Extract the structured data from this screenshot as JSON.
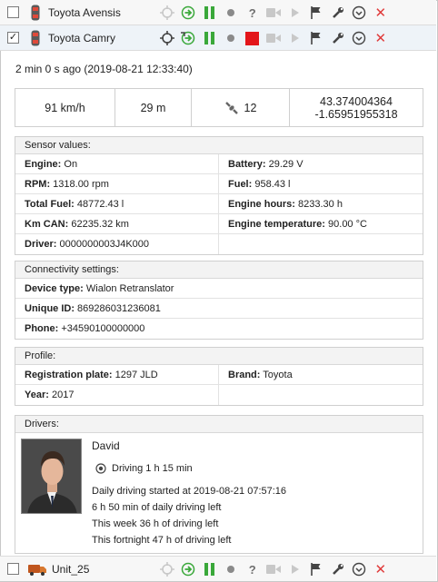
{
  "units": [
    {
      "name": "Toyota Avensis",
      "checked": false
    },
    {
      "name": "Toyota Camry",
      "checked": true
    },
    {
      "name": "Unit_25",
      "checked": false
    }
  ],
  "checkbox_mark": "✓",
  "icons": {
    "help": "?",
    "delete": "✕"
  },
  "info": {
    "time": "2 min 0 s ago (2019-08-21 12:33:40)",
    "speed": "91 km/h",
    "altitude": "29 m",
    "satellites": "12",
    "lat": "43.374004364",
    "lon": "-1.65951955318"
  },
  "sensors": {
    "title": "Sensor values:",
    "rows": [
      [
        {
          "k": "Engine:",
          "v": " On"
        },
        {
          "k": "Battery:",
          "v": " 29.29 V"
        }
      ],
      [
        {
          "k": "RPM:",
          "v": " 1318.00 rpm"
        },
        {
          "k": "Fuel:",
          "v": " 958.43 l"
        }
      ],
      [
        {
          "k": "Total Fuel:",
          "v": " 48772.43 l"
        },
        {
          "k": "Engine hours:",
          "v": " 8233.30 h"
        }
      ],
      [
        {
          "k": "Km CAN:",
          "v": " 62235.32 km"
        },
        {
          "k": "Engine temperature:",
          "v": " 90.00 °C"
        }
      ],
      [
        {
          "k": "Driver:",
          "v": " 0000000003J4K000"
        },
        {
          "k": "",
          "v": ""
        }
      ]
    ]
  },
  "connectivity": {
    "title": "Connectivity settings:",
    "rows": [
      {
        "k": "Device type:",
        "v": " Wialon Retranslator"
      },
      {
        "k": "Unique ID:",
        "v": " 869286031236081"
      },
      {
        "k": "Phone:",
        "v": " +34590100000000"
      }
    ]
  },
  "profile": {
    "title": "Profile:",
    "rows": [
      [
        {
          "k": "Registration plate:",
          "v": " 1297 JLD"
        },
        {
          "k": "Brand:",
          "v": " Toyota"
        }
      ],
      [
        {
          "k": "Year:",
          "v": " 2017"
        },
        {
          "k": "",
          "v": ""
        }
      ]
    ]
  },
  "drivers": {
    "title": "Drivers:",
    "name": "David",
    "status": "Driving 1 h 15 min",
    "lines": [
      "Daily driving started at 2019-08-21 07:57:16",
      "6 h 50 min of daily driving left",
      "This week 36 h of driving left",
      "This fortnight 47 h of driving left"
    ]
  },
  "colors": {
    "green": "#3aa83a",
    "red": "#e3161b",
    "grey_icon": "#8a8a8a"
  }
}
